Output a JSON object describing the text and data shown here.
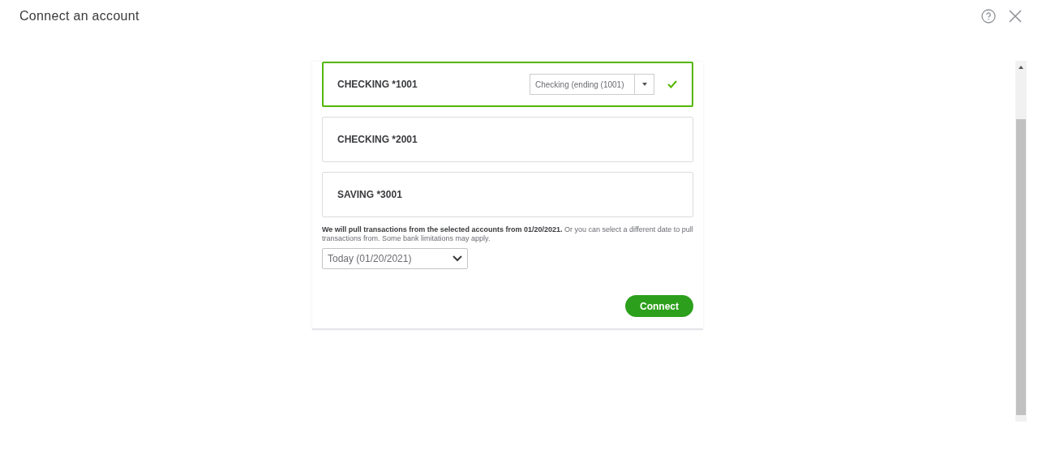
{
  "window": {
    "title": "Connect an account"
  },
  "accounts": [
    {
      "name": "CHECKING *1001",
      "selected": true,
      "match": "Checking (ending (1001)"
    },
    {
      "name": "CHECKING *2001",
      "selected": false
    },
    {
      "name": "SAVING *3001",
      "selected": false
    }
  ],
  "note": "**We will pull transactions from the selected accounts from 01/20/2021.** Or you can select a different date to pull transactions from. Some bank limitations may apply.",
  "date_select": {
    "value": "Today (01/20/2021)"
  },
  "buttons": [
    "Connect"
  ]
}
